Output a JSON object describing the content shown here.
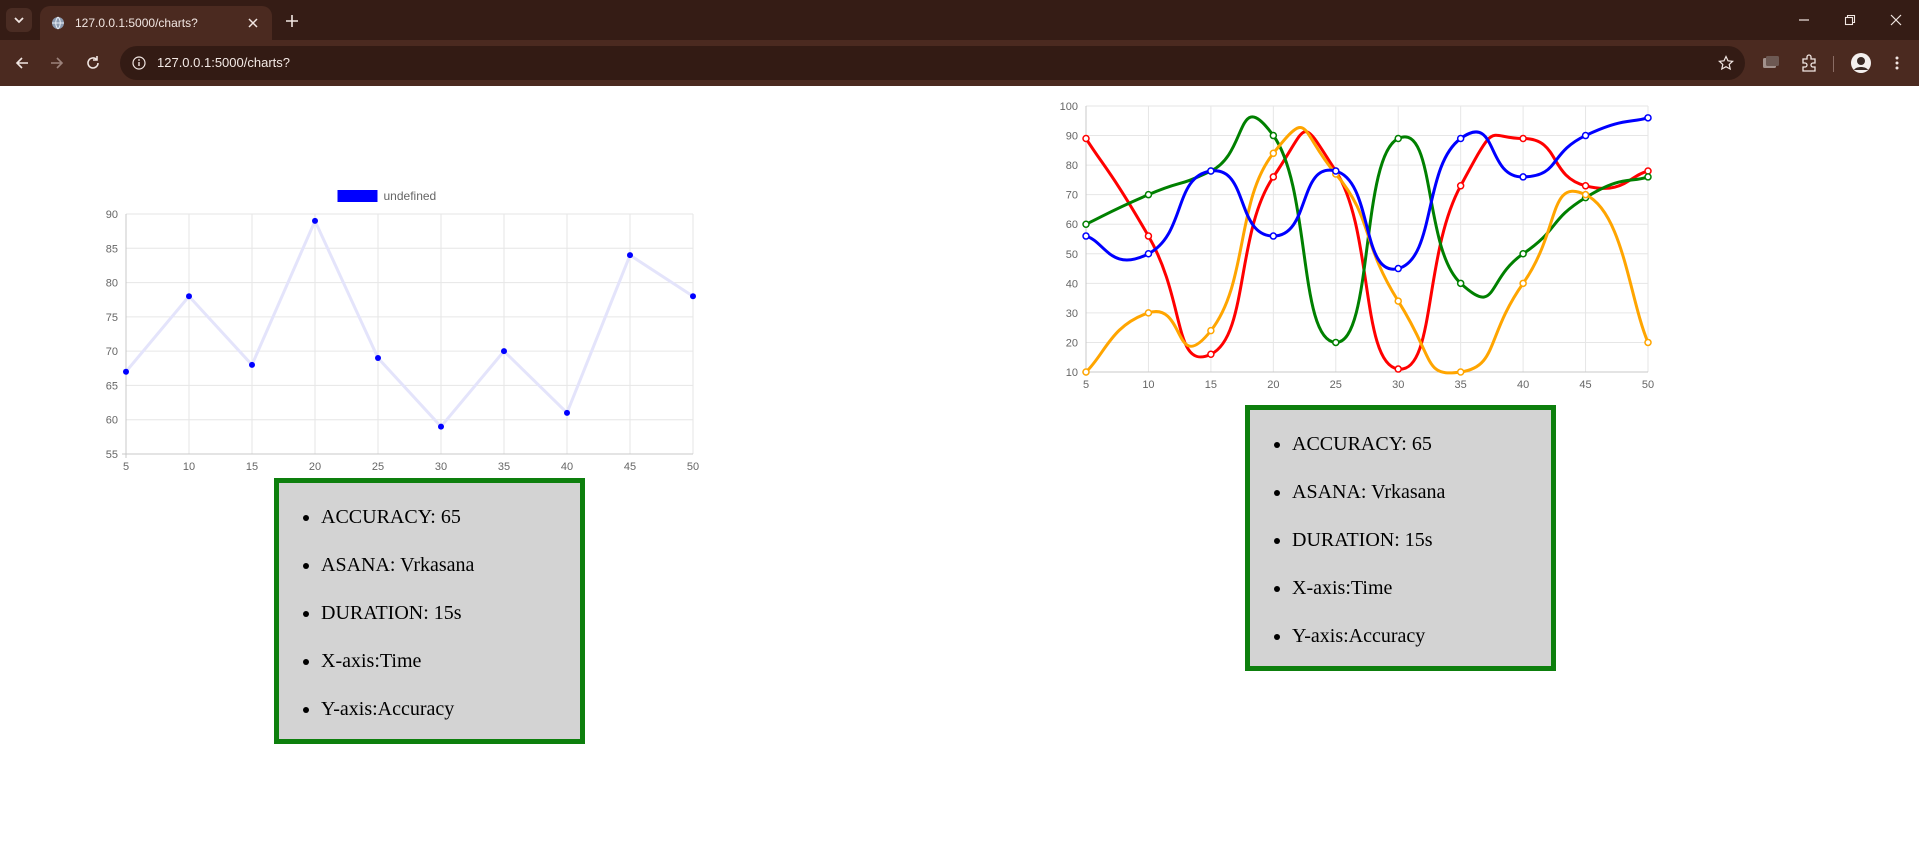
{
  "browser": {
    "tab_title": "127.0.0.1:5000/charts?",
    "url": "127.0.0.1:5000/charts?"
  },
  "info_lines": [
    "ACCURACY: 65",
    "ASANA: Vrkasana",
    "DURATION: 15s",
    "X-axis:Time",
    "Y-axis:Accuracy"
  ],
  "colors": {
    "box_border": "#0d7f0d",
    "box_bg": "#d3d3d3"
  },
  "chart_data": [
    {
      "type": "line",
      "x": [
        5,
        10,
        15,
        20,
        25,
        30,
        35,
        40,
        45,
        50
      ],
      "ylim": [
        55,
        90
      ],
      "yticks": [
        55,
        60,
        65,
        70,
        75,
        80,
        85,
        90
      ],
      "legend": "undefined",
      "legend_position": "top",
      "grid": true,
      "series": [
        {
          "color": "#0000ff",
          "line_color": "#e4e4fb",
          "values": [
            67,
            78,
            68,
            89,
            69,
            59,
            70,
            61,
            84,
            78
          ]
        }
      ]
    },
    {
      "type": "line",
      "x": [
        5,
        10,
        15,
        20,
        25,
        30,
        35,
        40,
        45,
        50
      ],
      "ylim": [
        10,
        100
      ],
      "yticks": [
        10,
        20,
        30,
        40,
        50,
        60,
        70,
        80,
        90,
        100
      ],
      "grid": true,
      "smooth": true,
      "series": [
        {
          "color": "#ff0000",
          "values": [
            89,
            56,
            16,
            76,
            78,
            11,
            73,
            89,
            73,
            78
          ]
        },
        {
          "color": "#008000",
          "values": [
            60,
            70,
            78,
            90,
            20,
            89,
            40,
            50,
            69,
            76
          ]
        },
        {
          "color": "#ffa500",
          "values": [
            10,
            30,
            24,
            84,
            77,
            34,
            10,
            40,
            70,
            20
          ]
        },
        {
          "color": "#0000ff",
          "values": [
            56,
            50,
            78,
            56,
            78,
            45,
            89,
            76,
            90,
            96
          ]
        }
      ]
    }
  ]
}
